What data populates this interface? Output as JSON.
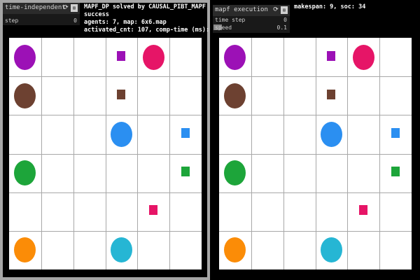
{
  "left": {
    "widget_title": "time-independent",
    "step_label": "step",
    "step_value": "0",
    "info_lines": [
      "MAPF_DP solved by CAUSAL_PIBT_MAPF",
      "success",
      "agents: 7, map: 6x6.map",
      "activated_cnt: 107, comp-time (ms): 0"
    ]
  },
  "right": {
    "widget_title": "mapf execution",
    "time_step_label": "time step",
    "time_step_value": "0",
    "speed_label": "speed",
    "speed_value": "0.1",
    "makespan_text": "makespan: 9, soc: 34"
  },
  "icons": [
    "refresh-icon",
    "collapse-icon"
  ],
  "grid": {
    "rows": 6,
    "cols": 6
  },
  "agents": [
    {
      "id": "purple",
      "color": "#9c11b6",
      "row": 0,
      "col": 0,
      "goal_row": 0,
      "goal_col": 3
    },
    {
      "id": "brown",
      "color": "#6d4131",
      "row": 1,
      "col": 0,
      "goal_row": 1,
      "goal_col": 3
    },
    {
      "id": "pink",
      "color": "#e61567",
      "row": 0,
      "col": 4,
      "goal_row": 4,
      "goal_col": 4
    },
    {
      "id": "blue",
      "color": "#2b8ff1",
      "row": 2,
      "col": 3,
      "goal_row": 2,
      "goal_col": 5
    },
    {
      "id": "green",
      "color": "#1da53a",
      "row": 3,
      "col": 0,
      "goal_row": 3,
      "goal_col": 5
    },
    {
      "id": "orange",
      "color": "#fb8c07",
      "row": 5,
      "col": 0,
      "goal_row": null,
      "goal_col": null
    },
    {
      "id": "cyan",
      "color": "#26b6d4",
      "row": 5,
      "col": 3,
      "goal_row": null,
      "goal_col": null
    }
  ]
}
